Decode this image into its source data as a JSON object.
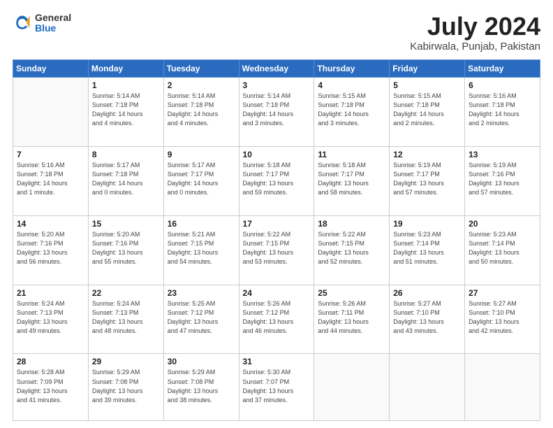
{
  "logo": {
    "general": "General",
    "blue": "Blue"
  },
  "title": {
    "month": "July 2024",
    "location": "Kabirwala, Punjab, Pakistan"
  },
  "days_of_week": [
    "Sunday",
    "Monday",
    "Tuesday",
    "Wednesday",
    "Thursday",
    "Friday",
    "Saturday"
  ],
  "weeks": [
    [
      {
        "day": "",
        "info": ""
      },
      {
        "day": "1",
        "info": "Sunrise: 5:14 AM\nSunset: 7:18 PM\nDaylight: 14 hours\nand 4 minutes."
      },
      {
        "day": "2",
        "info": "Sunrise: 5:14 AM\nSunset: 7:18 PM\nDaylight: 14 hours\nand 4 minutes."
      },
      {
        "day": "3",
        "info": "Sunrise: 5:14 AM\nSunset: 7:18 PM\nDaylight: 14 hours\nand 3 minutes."
      },
      {
        "day": "4",
        "info": "Sunrise: 5:15 AM\nSunset: 7:18 PM\nDaylight: 14 hours\nand 3 minutes."
      },
      {
        "day": "5",
        "info": "Sunrise: 5:15 AM\nSunset: 7:18 PM\nDaylight: 14 hours\nand 2 minutes."
      },
      {
        "day": "6",
        "info": "Sunrise: 5:16 AM\nSunset: 7:18 PM\nDaylight: 14 hours\nand 2 minutes."
      }
    ],
    [
      {
        "day": "7",
        "info": "Sunrise: 5:16 AM\nSunset: 7:18 PM\nDaylight: 14 hours\nand 1 minute."
      },
      {
        "day": "8",
        "info": "Sunrise: 5:17 AM\nSunset: 7:18 PM\nDaylight: 14 hours\nand 0 minutes."
      },
      {
        "day": "9",
        "info": "Sunrise: 5:17 AM\nSunset: 7:17 PM\nDaylight: 14 hours\nand 0 minutes."
      },
      {
        "day": "10",
        "info": "Sunrise: 5:18 AM\nSunset: 7:17 PM\nDaylight: 13 hours\nand 59 minutes."
      },
      {
        "day": "11",
        "info": "Sunrise: 5:18 AM\nSunset: 7:17 PM\nDaylight: 13 hours\nand 58 minutes."
      },
      {
        "day": "12",
        "info": "Sunrise: 5:19 AM\nSunset: 7:17 PM\nDaylight: 13 hours\nand 57 minutes."
      },
      {
        "day": "13",
        "info": "Sunrise: 5:19 AM\nSunset: 7:16 PM\nDaylight: 13 hours\nand 57 minutes."
      }
    ],
    [
      {
        "day": "14",
        "info": "Sunrise: 5:20 AM\nSunset: 7:16 PM\nDaylight: 13 hours\nand 56 minutes."
      },
      {
        "day": "15",
        "info": "Sunrise: 5:20 AM\nSunset: 7:16 PM\nDaylight: 13 hours\nand 55 minutes."
      },
      {
        "day": "16",
        "info": "Sunrise: 5:21 AM\nSunset: 7:15 PM\nDaylight: 13 hours\nand 54 minutes."
      },
      {
        "day": "17",
        "info": "Sunrise: 5:22 AM\nSunset: 7:15 PM\nDaylight: 13 hours\nand 53 minutes."
      },
      {
        "day": "18",
        "info": "Sunrise: 5:22 AM\nSunset: 7:15 PM\nDaylight: 13 hours\nand 52 minutes."
      },
      {
        "day": "19",
        "info": "Sunrise: 5:23 AM\nSunset: 7:14 PM\nDaylight: 13 hours\nand 51 minutes."
      },
      {
        "day": "20",
        "info": "Sunrise: 5:23 AM\nSunset: 7:14 PM\nDaylight: 13 hours\nand 50 minutes."
      }
    ],
    [
      {
        "day": "21",
        "info": "Sunrise: 5:24 AM\nSunset: 7:13 PM\nDaylight: 13 hours\nand 49 minutes."
      },
      {
        "day": "22",
        "info": "Sunrise: 5:24 AM\nSunset: 7:13 PM\nDaylight: 13 hours\nand 48 minutes."
      },
      {
        "day": "23",
        "info": "Sunrise: 5:25 AM\nSunset: 7:12 PM\nDaylight: 13 hours\nand 47 minutes."
      },
      {
        "day": "24",
        "info": "Sunrise: 5:26 AM\nSunset: 7:12 PM\nDaylight: 13 hours\nand 46 minutes."
      },
      {
        "day": "25",
        "info": "Sunrise: 5:26 AM\nSunset: 7:11 PM\nDaylight: 13 hours\nand 44 minutes."
      },
      {
        "day": "26",
        "info": "Sunrise: 5:27 AM\nSunset: 7:10 PM\nDaylight: 13 hours\nand 43 minutes."
      },
      {
        "day": "27",
        "info": "Sunrise: 5:27 AM\nSunset: 7:10 PM\nDaylight: 13 hours\nand 42 minutes."
      }
    ],
    [
      {
        "day": "28",
        "info": "Sunrise: 5:28 AM\nSunset: 7:09 PM\nDaylight: 13 hours\nand 41 minutes."
      },
      {
        "day": "29",
        "info": "Sunrise: 5:29 AM\nSunset: 7:08 PM\nDaylight: 13 hours\nand 39 minutes."
      },
      {
        "day": "30",
        "info": "Sunrise: 5:29 AM\nSunset: 7:08 PM\nDaylight: 13 hours\nand 38 minutes."
      },
      {
        "day": "31",
        "info": "Sunrise: 5:30 AM\nSunset: 7:07 PM\nDaylight: 13 hours\nand 37 minutes."
      },
      {
        "day": "",
        "info": ""
      },
      {
        "day": "",
        "info": ""
      },
      {
        "day": "",
        "info": ""
      }
    ]
  ]
}
